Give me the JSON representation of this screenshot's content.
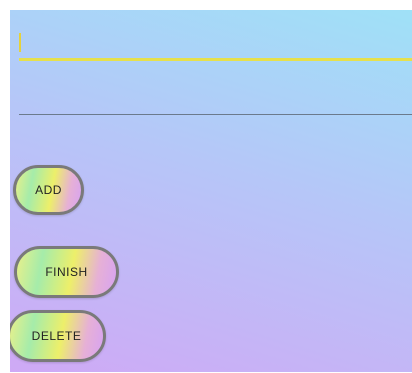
{
  "form": {
    "first_input": {
      "value": "",
      "placeholder": ""
    },
    "second_input": {
      "value": "",
      "placeholder": ""
    }
  },
  "buttons": {
    "add_label": "ADD",
    "finish_label": "FINISH",
    "delete_label": "DELETE"
  },
  "colors": {
    "background_top": "#9fe1f7",
    "background_bottom": "#cfa9f5",
    "focused_underline": "#e6e04c",
    "unfocused_underline": "#6b7a8c",
    "button_border": "#7a7a7a"
  }
}
